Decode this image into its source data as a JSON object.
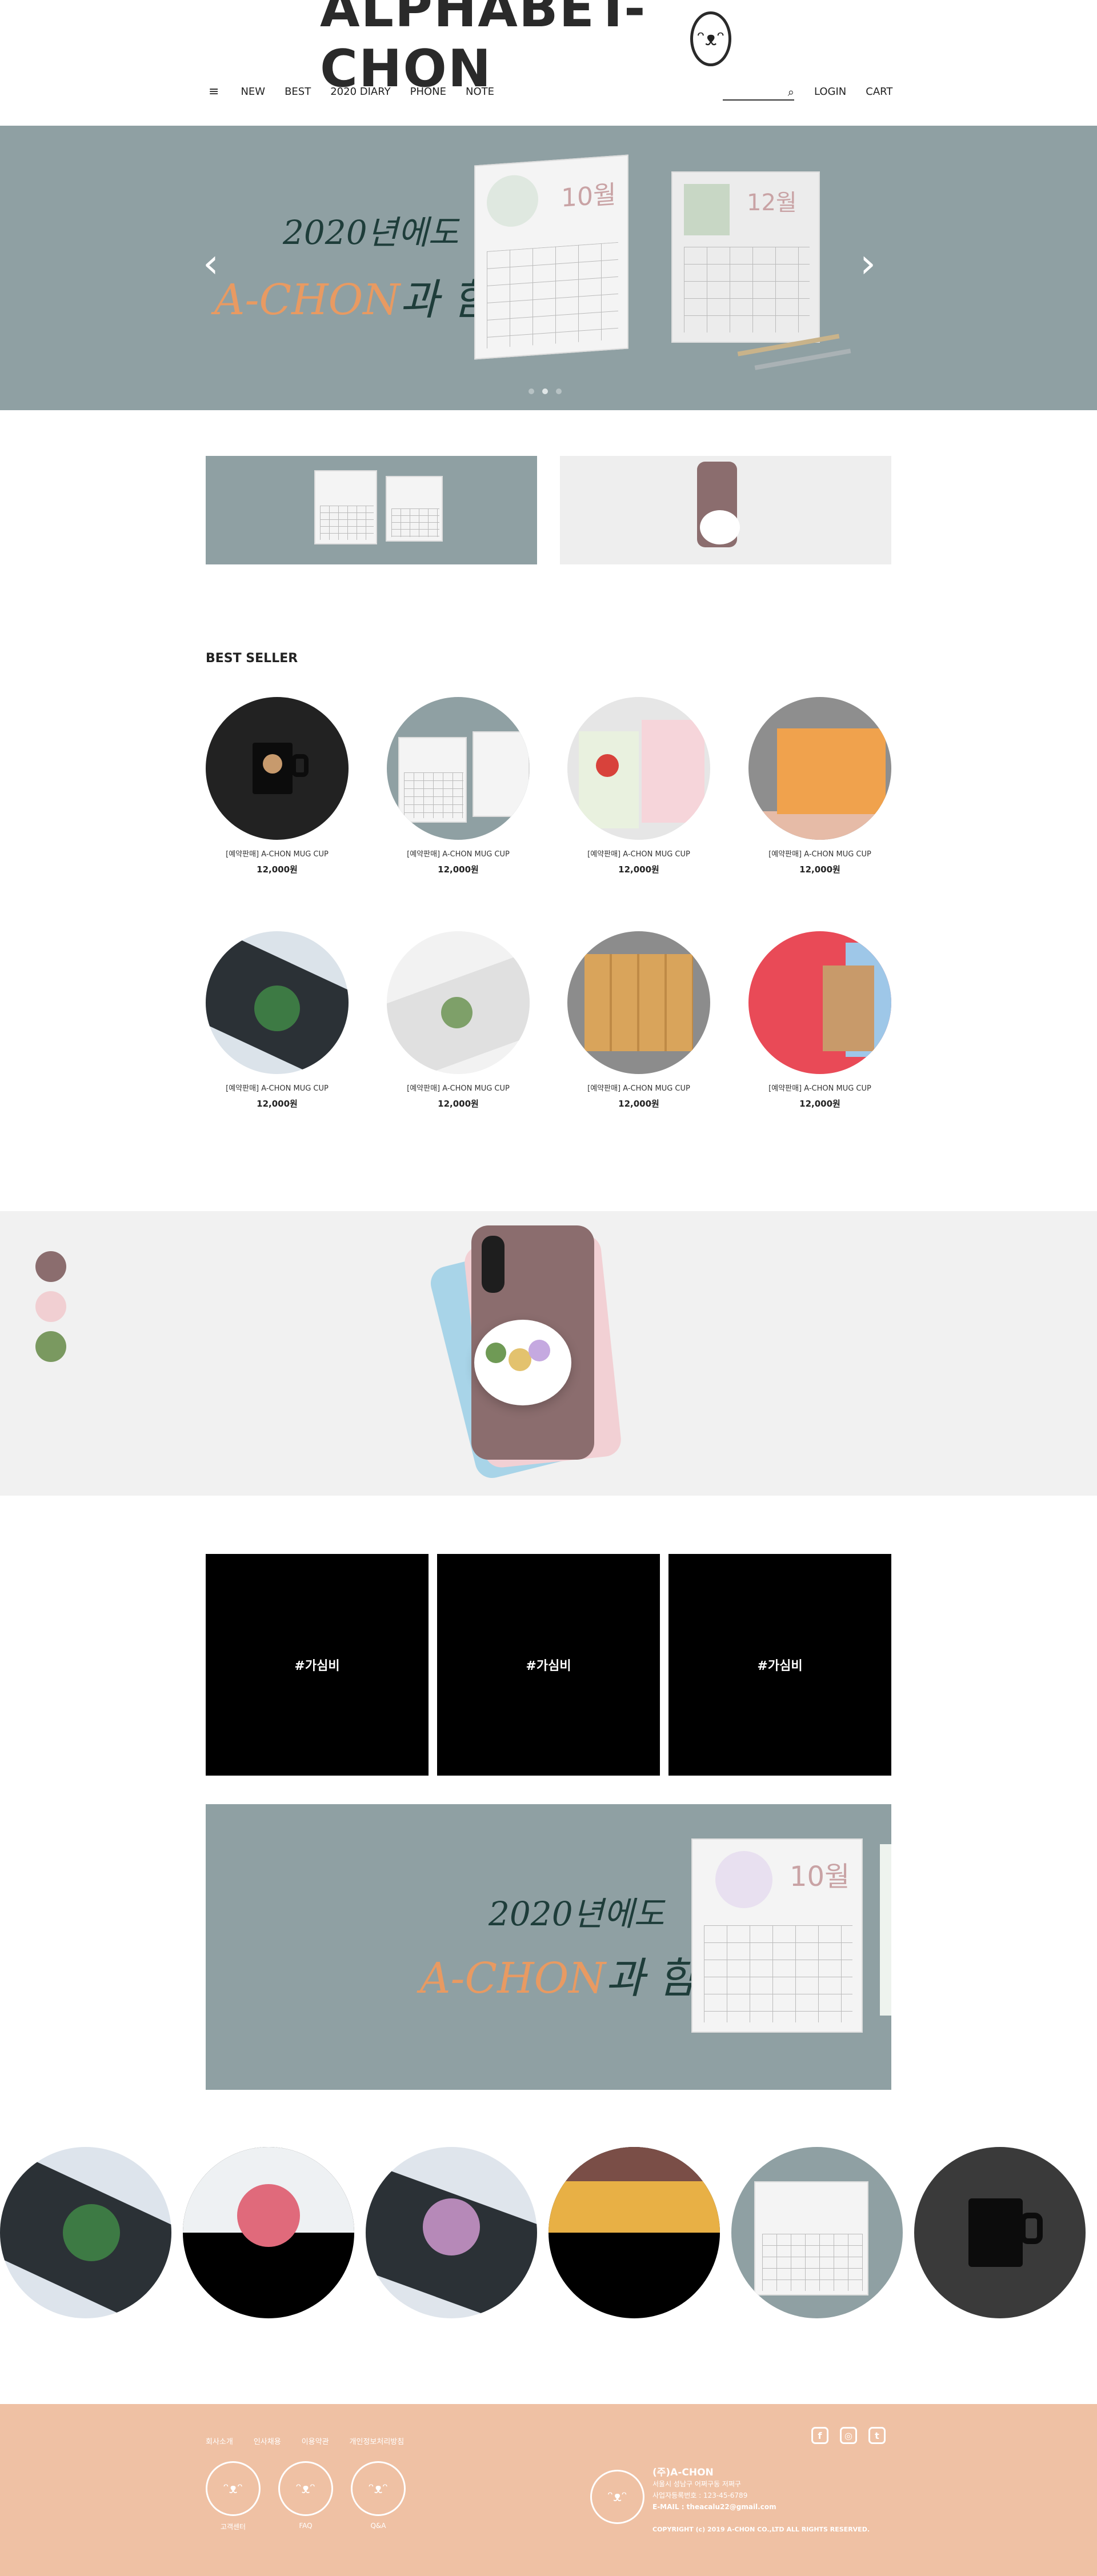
{
  "header": {
    "logo_text": "ALPHABET-CHON",
    "menu_icon": "≡",
    "nav": [
      "NEW",
      "BEST",
      "2020 DIARY",
      "PHONE",
      "NOTE"
    ],
    "search_icon": "⌕",
    "login": "LOGIN",
    "cart": "CART"
  },
  "hero": {
    "line1": "2020년에도",
    "accent": "A-CHON",
    "line2_rest": "과 함께",
    "cal_month_a": "10월",
    "cal_month_b": "12월",
    "prev_icon": "‹",
    "next_icon": "›",
    "accent_color": "#e89a62",
    "bg_color": "#8fa0a3"
  },
  "best": {
    "title": "BEST SELLER",
    "products": [
      {
        "name": "[예약판매] A-CHON MUG CUP",
        "price": "12,000원"
      },
      {
        "name": "[예약판매] A-CHON MUG CUP",
        "price": "12,000원"
      },
      {
        "name": "[예약판매] A-CHON MUG CUP",
        "price": "12,000원"
      },
      {
        "name": "[예약판매] A-CHON MUG CUP",
        "price": "12,000원"
      },
      {
        "name": "[예약판매] A-CHON MUG CUP",
        "price": "12,000원"
      },
      {
        "name": "[예약판매] A-CHON MUG CUP",
        "price": "12,000원"
      },
      {
        "name": "[예약판매] A-CHON MUG CUP",
        "price": "12,000원"
      },
      {
        "name": "[예약판매] A-CHON MUG CUP",
        "price": "12,000원"
      }
    ]
  },
  "colors": {
    "swatches": [
      "#8b6d6e",
      "#f1cfd2",
      "#7a9960"
    ]
  },
  "tiles": [
    "#가심비",
    "#가심비",
    "#가심비"
  ],
  "banner2": {
    "line1": "2020년에도",
    "accent": "A-CHON",
    "line2_rest": "과 함께",
    "cal_month": "10월"
  },
  "footer": {
    "links": [
      "회사소개",
      "인사채용",
      "이용약관",
      "개인정보처리방침"
    ],
    "circles": [
      {
        "label": "고객센터",
        "icon": "ᵔᴥᵔ"
      },
      {
        "label": "FAQ",
        "icon": "ᵔᴥᵔ"
      },
      {
        "label": "Q&A",
        "icon": "ᵔᴥᵔ"
      }
    ],
    "sns": [
      "f",
      "◎",
      "t"
    ],
    "company": "(주)A-CHON",
    "address": "서울시 성남구 어쩌구동 저쩌구",
    "bizno": "사업자등록번호 : 123-45-6789",
    "email": "E-MAIL : theacalu22@gmail.com",
    "copyright": "COPYRIGHT (c) 2019 A-CHON CO.,LTD ALL RIGHTS RESERVED."
  }
}
